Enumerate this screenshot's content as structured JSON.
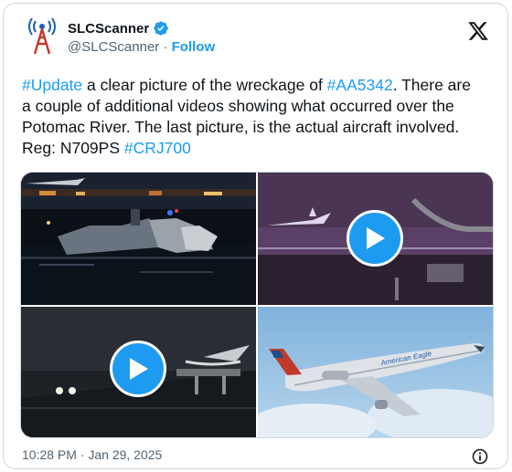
{
  "author": {
    "display_name": "SLCScanner",
    "handle": "@SLCScanner",
    "separator": "·",
    "follow_label": "Follow",
    "avatar_icon": "radio-tower-icon",
    "verified_icon": "verified-badge-icon"
  },
  "tweet": {
    "hashtag_update": "#Update",
    "text_1": " a clear picture of the wreckage of ",
    "hashtag_flight": "#AA5342",
    "text_2": ". There are a couple of additional videos showing what occurred over the Potomac River. The last picture, is the actual aircraft involved. Reg: N709PS ",
    "hashtag_type": "#CRJ700"
  },
  "media": {
    "aircraft_livery": "American Eagle"
  },
  "footer": {
    "timestamp": "10:28 PM · Jan 29, 2025"
  },
  "colors": {
    "accent": "#1d9bf0",
    "text": "#0f1419",
    "secondary": "#536471",
    "border": "#cfd9de"
  }
}
